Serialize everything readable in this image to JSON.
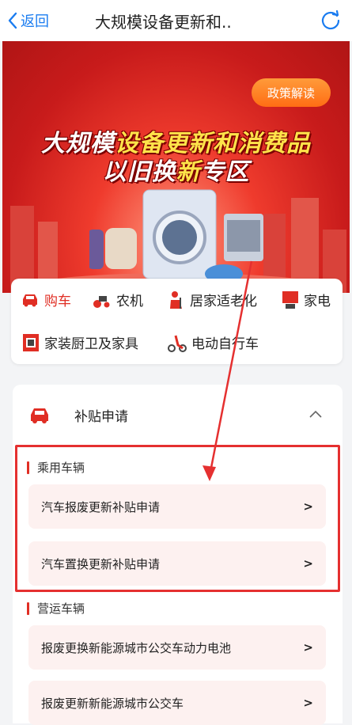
{
  "topbar": {
    "back_label": "返回",
    "title": "大规模设备更新和.."
  },
  "banner": {
    "policy_label": "政策解读",
    "headline_line1_a": "大规模",
    "headline_line1_b": "设备更新和",
    "headline_line1_c": "消费品",
    "headline_line2_a": "以旧换",
    "headline_line2_b": "新",
    "headline_line2_c": "专区"
  },
  "categories": [
    {
      "label": "购车",
      "icon": "car-icon",
      "active": true
    },
    {
      "label": "农机",
      "icon": "farm-machine-icon"
    },
    {
      "label": "居家适老化",
      "icon": "elder-care-icon"
    },
    {
      "label": "家电",
      "icon": "appliance-icon"
    },
    {
      "label": "家装厨卫及家具",
      "icon": "kitchen-icon"
    },
    {
      "label": "电动自行车",
      "icon": "ebike-icon"
    }
  ],
  "subsidy": {
    "header": "补贴申请",
    "sections": [
      {
        "title": "乘用车辆",
        "items": [
          "汽车报废更新补贴申请",
          "汽车置换更新补贴申请"
        ]
      },
      {
        "title": "营运车辆",
        "items": [
          "报废更换新能源城市公交车动力电池",
          "报废更新新能源城市公交车"
        ]
      }
    ],
    "arrow": ">"
  },
  "colors": {
    "accent": "#e02e24",
    "link": "#1a7cf0",
    "policy": "#ff7a1f"
  }
}
